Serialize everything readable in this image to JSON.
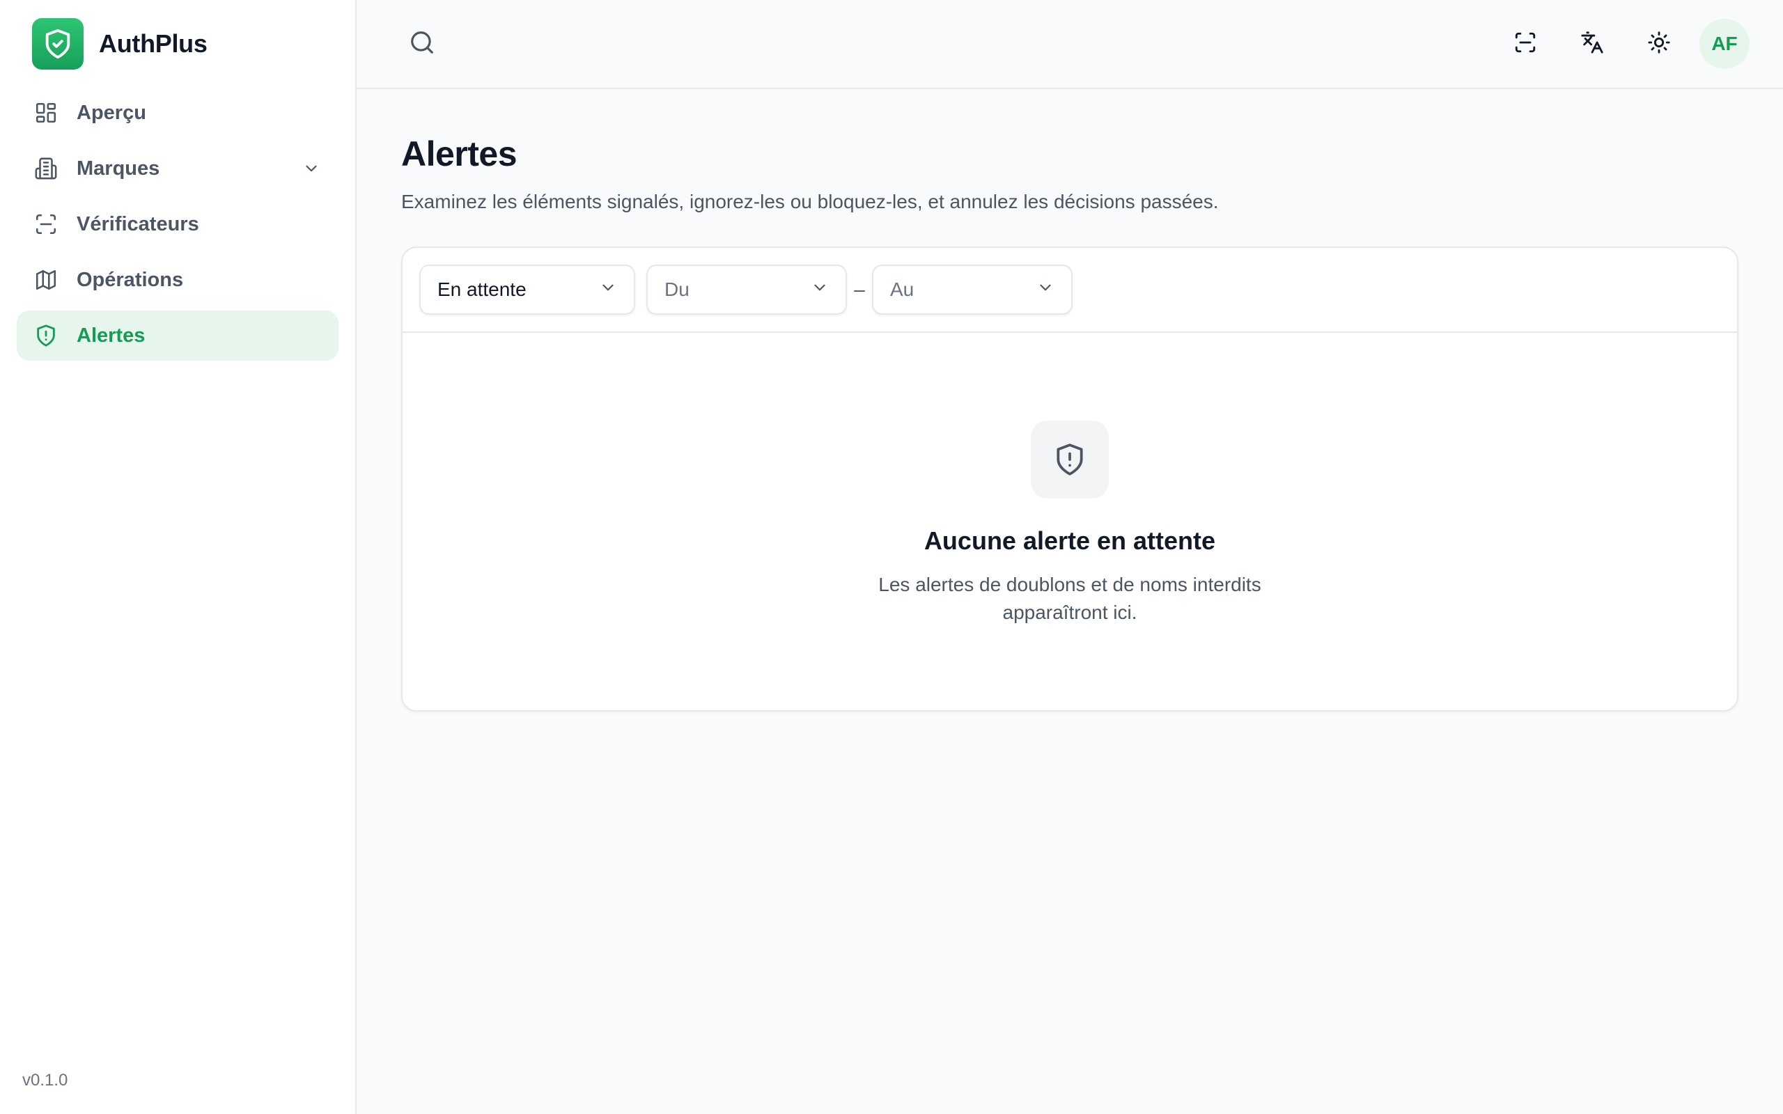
{
  "app": {
    "name": "AuthPlus",
    "version": "v0.1.0",
    "accent_color": "#169b55",
    "accent_bg": "#e6f6ec"
  },
  "sidebar": {
    "items": [
      {
        "label": "Aperçu",
        "icon": "layout-grid-icon",
        "active": false
      },
      {
        "label": "Marques",
        "icon": "building-icon",
        "active": false,
        "has_submenu": true
      },
      {
        "label": "Vérificateurs",
        "icon": "scan-icon",
        "active": false
      },
      {
        "label": "Opérations",
        "icon": "map-icon",
        "active": false
      },
      {
        "label": "Alertes",
        "icon": "shield-alert-icon",
        "active": true
      }
    ]
  },
  "topbar": {
    "search_icon": "search-icon",
    "actions": [
      "scan-icon",
      "translate-icon",
      "sun-icon"
    ],
    "avatar_initials": "AF"
  },
  "page": {
    "title": "Alertes",
    "subtitle": "Examinez les éléments signalés, ignorez-les ou bloquez-les, et annulez les décisions passées."
  },
  "filters": {
    "status_value": "En attente",
    "from_placeholder": "Du",
    "separator": "–",
    "to_placeholder": "Au"
  },
  "empty_state": {
    "icon": "shield-alert-icon",
    "title": "Aucune alerte en attente",
    "text": "Les alertes de doublons et de noms interdits apparaîtront ici."
  }
}
